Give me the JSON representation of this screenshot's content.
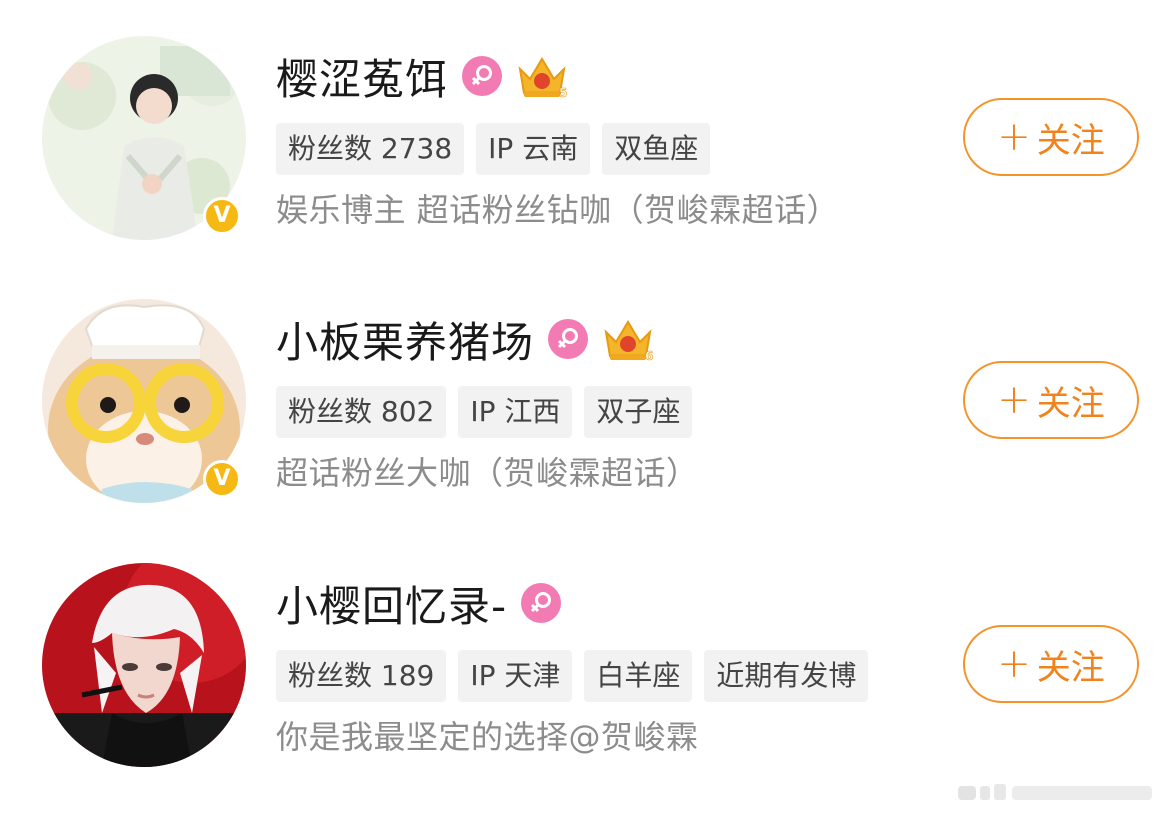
{
  "users": [
    {
      "name": "樱涩菟饵",
      "tags": [
        "粉丝数 2738",
        "IP 云南",
        "双鱼座"
      ],
      "bio": "娱乐博主 超话粉丝钻咖（贺峻霖超话）",
      "follow_label": "关注",
      "crown_level": "5",
      "verified_mark": "V",
      "avatar_desc": "person-in-garden-avatar"
    },
    {
      "name": "小板栗养猪场",
      "tags": [
        "粉丝数 802",
        "IP 江西",
        "双子座"
      ],
      "bio": "超话粉丝大咖（贺峻霖超话）",
      "follow_label": "关注",
      "crown_level": "6",
      "verified_mark": "V",
      "avatar_desc": "hamster-with-glasses-avatar"
    },
    {
      "name": "小樱回忆录-",
      "tags": [
        "粉丝数 189",
        "IP 天津",
        "白羊座",
        "近期有发博"
      ],
      "bio": "你是我最坚定的选择@贺峻霖",
      "follow_label": "关注",
      "avatar_desc": "white-haired-singer-avatar"
    }
  ],
  "colors": {
    "accent": "#f0831d",
    "gender": "#f27bb4",
    "verified": "#f6b913",
    "tag_bg": "#f2f2f2",
    "bio": "#8c8c8c"
  },
  "icons": {
    "gender": "female-icon",
    "verified": "verified-badge-icon",
    "crown": "crown-level-icon",
    "plus": "plus-icon"
  }
}
